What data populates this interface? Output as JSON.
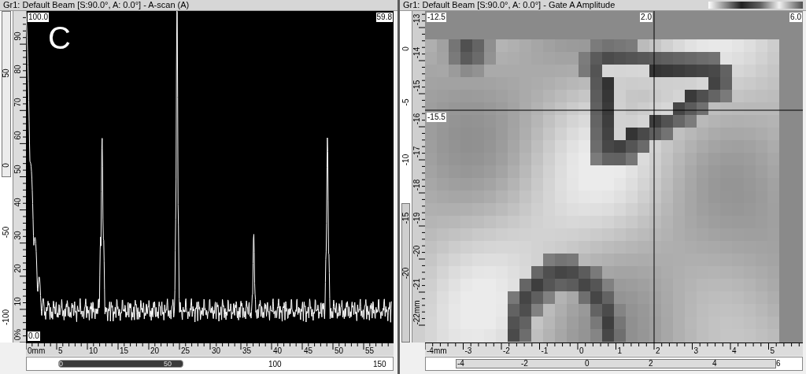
{
  "ascan_panel": {
    "title": "Gr1: Default Beam [S:90.0°, A: 0.0°] - A-scan (A)",
    "corner_labels": [
      "100.0",
      "59.8",
      "0.0"
    ],
    "marker": "C",
    "outer_axis": {
      "labels": [
        "-100",
        "-50",
        "0",
        "50"
      ],
      "slider": {
        "level": 0.5
      }
    },
    "amplitude_axis": {
      "labels": [
        "0%",
        "10",
        "20",
        "30",
        "40",
        "50",
        "60",
        "70",
        "80",
        "90"
      ]
    },
    "depth_axis": {
      "labels": [
        "0mm",
        "5",
        "10",
        "15",
        "20",
        "25",
        "30",
        "35",
        "40",
        "45",
        "50",
        "55"
      ]
    },
    "scroll_axis": {
      "labels": [
        "0",
        "50",
        "100",
        "150"
      ]
    }
  },
  "cscan_panel": {
    "title": "Gr1: Default Beam [S:90.0°, A: 0.0°] -  Gate A Amplitude",
    "cursor_labels": [
      "-12.5",
      "2.0",
      "6.0",
      "-15.5"
    ],
    "outer_axis": {
      "labels": [
        "0",
        "-5",
        "-10",
        "-15",
        "-20"
      ],
      "slider": {
        "level": 0.42
      }
    },
    "scan_axis": {
      "labels": [
        "-13",
        "-14",
        "-15",
        "-16",
        "-17",
        "-18",
        "-19",
        "-20",
        "-21",
        "-22mm"
      ]
    },
    "index_axis": {
      "labels": [
        "-4mm",
        "-3",
        "-2",
        "-1",
        "0",
        "1",
        "2",
        "3",
        "4",
        "5"
      ]
    },
    "scroll_axis": {
      "labels": [
        "-4",
        "-2",
        "0",
        "2",
        "4",
        "6"
      ]
    }
  }
}
